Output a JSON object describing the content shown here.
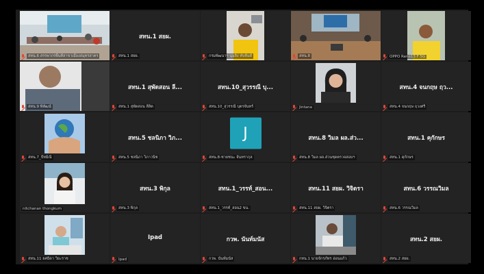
{
  "participants": [
    {
      "name": "",
      "label": "สทน.6 สรรพากรพื้นที่สาขาเมืองสมุทรสาคร"
    },
    {
      "name": "สทน.1 สยผ.",
      "label": "สทน.1 สยผ."
    },
    {
      "name": "",
      "label": "กรมพัฒนาฯ นุ่มสิ่ง ทับทิมดี"
    },
    {
      "name": "",
      "label": "สทน.8"
    },
    {
      "name": "",
      "label": "OPPO Reno13 F 5G"
    },
    {
      "name": "",
      "label": "สทน.9 พิพัฒน์"
    },
    {
      "name": "สทน.1 สุพัดสอน ลี...",
      "label": "สทน.1 สุพัดสอน ลีลิต"
    },
    {
      "name": "สทน.10_สุวรรณี บุ...",
      "label": "สทน.10_สุวรรณี บุตรจันทร์"
    },
    {
      "name": "",
      "label": "Jintana"
    },
    {
      "name": "สทน.4 จนกฤษ ฤว...",
      "label": "สทน.4 จนกฤษ ฤวงศรี"
    },
    {
      "name": "",
      "label": "สทน.7_ปัทมิณี"
    },
    {
      "name": "สทน.5 ชลนิภา วิภ...",
      "label": "สทน.5 ชลนิภา วิภาวนิช"
    },
    {
      "name": "",
      "label": "สทน.8-ชายชนะ จันทรากุล",
      "avatar": "J"
    },
    {
      "name": "สทน.8 วิมล ผล.ส่ว...",
      "label": "สทน.8 วิมล ผล.ส่วนชุดตรวจสอบฯ"
    },
    {
      "name": "สทน.1 คุกักษร",
      "label": "สทน.1 คุกักษร"
    },
    {
      "name": "",
      "label": "nitchanan thongkum"
    },
    {
      "name": "สทน.3 พิกุล",
      "label": "สทน.3 พิกุล"
    },
    {
      "name": "สทน.1_วรรท์_สอน...",
      "label": "สทน.1_วรรท์_สอน2 ขน."
    },
    {
      "name": "สทน.11 สยผ. วิจิตรา",
      "label": "สทน.11 สยผ. วิจิตรา"
    },
    {
      "name": "สทน.6 วรรณวิมล",
      "label": "สทน.6 วรรณวิมล"
    },
    {
      "name": "",
      "label": "สทน.11 ยศธิดา วิยะราช"
    },
    {
      "name": "Ipad",
      "label": "Ipad"
    },
    {
      "name": "กวพ. นันท์มนัส",
      "label": "กวพ. นันท์มนัส"
    },
    {
      "name": "",
      "label": "กทน.1 นายจักรภัทร อ่อนแก้ว"
    },
    {
      "name": "สทน.2 สยผ.",
      "label": "สทน.2 สยผ."
    }
  ],
  "colors": {
    "active_border": "#3ec96a",
    "muted_mic": "#e0463a",
    "avatar_bg": "#1fa2b8",
    "tile_bg": "#232323"
  }
}
